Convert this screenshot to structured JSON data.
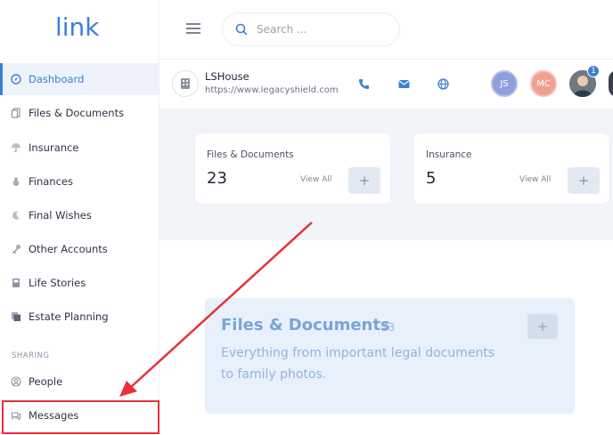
{
  "sidebar": {
    "logo_text": "link",
    "items": [
      {
        "label": "Dashboard",
        "icon": "compass-icon",
        "active": true
      },
      {
        "label": "Files & Documents",
        "icon": "files-icon"
      },
      {
        "label": "Insurance",
        "icon": "umbrella-icon"
      },
      {
        "label": "Finances",
        "icon": "money-bag-icon"
      },
      {
        "label": "Final Wishes",
        "icon": "moon-icon"
      },
      {
        "label": "Other Accounts",
        "icon": "key-icon"
      },
      {
        "label": "Life Stories",
        "icon": "book-icon"
      },
      {
        "label": "Estate Planning",
        "icon": "documents-icon"
      }
    ],
    "sharing_label": "SHARING",
    "sharing_items": [
      {
        "label": "People",
        "icon": "user-circle-icon"
      },
      {
        "label": "Messages",
        "icon": "chat-icon"
      }
    ]
  },
  "topbar": {
    "search_placeholder": "Search ..."
  },
  "account": {
    "name": "LSHouse",
    "url": "https://www.legacyshield.com",
    "avatars": [
      {
        "initials": "JS",
        "color": "#8f9fdc"
      },
      {
        "initials": "MC",
        "color": "#f0a090"
      }
    ],
    "badge_count": "1"
  },
  "cards": [
    {
      "title": "Files & Documents",
      "count": "23",
      "view_all": "View All",
      "add": "+"
    },
    {
      "title": "Insurance",
      "count": "5",
      "view_all": "View All",
      "add": "+"
    }
  ],
  "feature": {
    "title": "Files & Documents",
    "count": "23",
    "description": "Everything from important legal documents to family photos.",
    "add": "+"
  },
  "colors": {
    "accent": "#3d7fd6",
    "annotation": "#e8303a"
  }
}
